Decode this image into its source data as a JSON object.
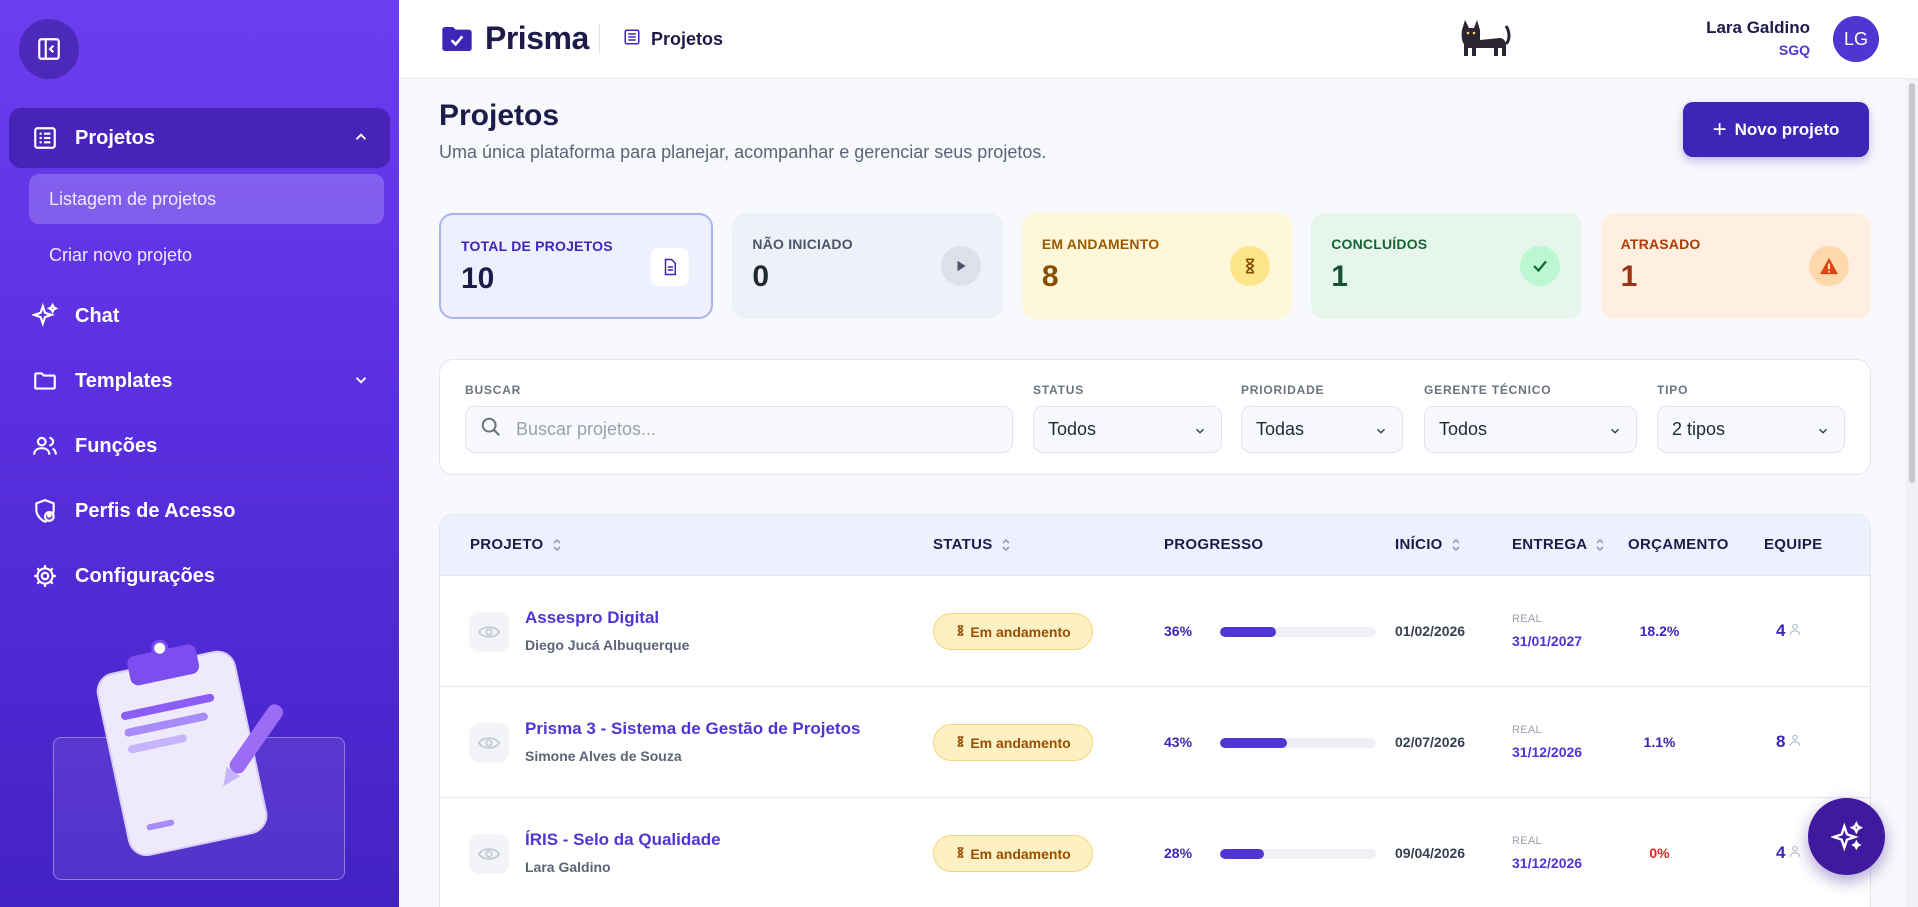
{
  "sidebar": {
    "items": [
      {
        "label": "Projetos",
        "icon": "list-icon",
        "expanded": true,
        "children": [
          {
            "label": "Listagem de projetos",
            "active": true
          },
          {
            "label": "Criar novo projeto"
          }
        ]
      },
      {
        "label": "Chat",
        "icon": "sparkles-icon"
      },
      {
        "label": "Templates",
        "icon": "folder-icon",
        "expanded": false
      },
      {
        "label": "Funções",
        "icon": "users-icon"
      },
      {
        "label": "Perfis de Acesso",
        "icon": "shield-user-icon"
      },
      {
        "label": "Configurações",
        "icon": "gear-icon"
      }
    ]
  },
  "header": {
    "brand": "Prisma",
    "breadcrumb": "Projetos",
    "user": {
      "name": "Lara Galdino",
      "role": "SGQ",
      "initials": "LG"
    }
  },
  "page": {
    "title": "Projetos",
    "subtitle": "Uma única plataforma para planejar, acompanhar e gerenciar seus projetos.",
    "new_button": "Novo projeto"
  },
  "stats": [
    {
      "label": "TOTAL DE PROJETOS",
      "value": "10"
    },
    {
      "label": "NÃO INICIADO",
      "value": "0"
    },
    {
      "label": "EM ANDAMENTO",
      "value": "8"
    },
    {
      "label": "CONCLUÍDOS",
      "value": "1"
    },
    {
      "label": "ATRASADO",
      "value": "1"
    }
  ],
  "filters": {
    "search": {
      "label": "BUSCAR",
      "placeholder": "Buscar projetos..."
    },
    "status": {
      "label": "STATUS",
      "value": "Todos"
    },
    "priority": {
      "label": "PRIORIDADE",
      "value": "Todas"
    },
    "manager": {
      "label": "GERENTE TÉCNICO",
      "value": "Todos"
    },
    "type": {
      "label": "TIPO",
      "value": "2 tipos"
    }
  },
  "table": {
    "columns": [
      "PROJETO",
      "STATUS",
      "PROGRESSO",
      "INÍCIO",
      "ENTREGA",
      "ORÇAMENTO",
      "EQUIPE"
    ],
    "rows": [
      {
        "name": "Assespro Digital",
        "manager": "Diego Jucá Albuquerque",
        "status": "Em andamento",
        "progress": 36,
        "progress_label": "36%",
        "start": "01/02/2026",
        "delivery_label": "REAL",
        "delivery": "31/01/2027",
        "budget": "18.2%",
        "team": "4"
      },
      {
        "name": "Prisma 3 - Sistema de Gestão de Projetos",
        "manager": "Simone Alves de Souza",
        "status": "Em andamento",
        "progress": 43,
        "progress_label": "43%",
        "start": "02/07/2026",
        "delivery_label": "REAL",
        "delivery": "31/12/2026",
        "budget": "1.1%",
        "team": "8"
      },
      {
        "name": "ÍRIS - Selo da Qualidade",
        "manager": "Lara Galdino",
        "status": "Em andamento",
        "progress": 28,
        "progress_label": "28%",
        "start": "09/04/2026",
        "delivery_label": "REAL",
        "delivery": "31/12/2026",
        "budget": "0%",
        "team": "4"
      }
    ]
  },
  "colors": {
    "accent": "#4f35d2",
    "sidebar": "#5a2fe0",
    "warning": "#dc2626"
  }
}
